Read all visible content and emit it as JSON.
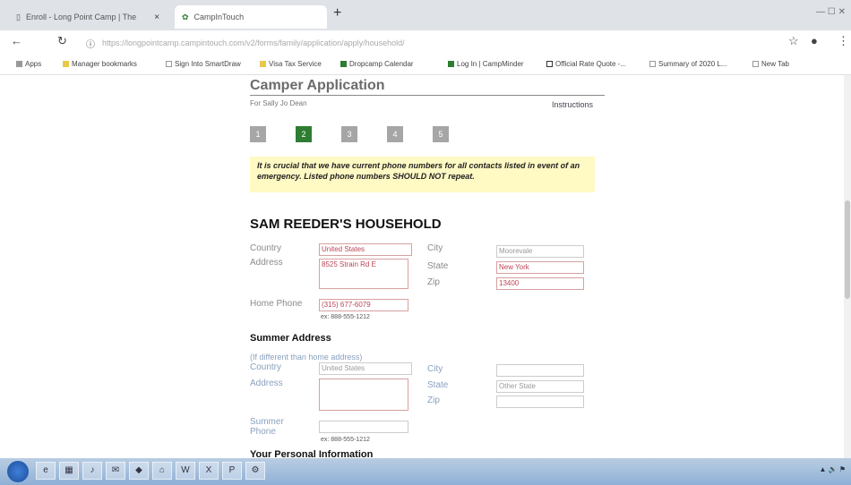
{
  "browser": {
    "tabs": [
      {
        "label": "Enroll - Long Point Camp | The",
        "close": "×"
      },
      {
        "label": "CampInTouch",
        "close": ""
      }
    ],
    "new_tab": "+",
    "url": "https://longpointcamp.campintouch.com/v2/forms/family/application/apply/household/"
  },
  "bookmarks": [
    {
      "label": "Apps",
      "icon": "apps-icon"
    },
    {
      "label": "Manager bookmarks",
      "icon": "folder-icon"
    },
    {
      "label": "Sign Into SmartDraw",
      "icon": "page-icon"
    },
    {
      "label": "Visa Tax Service",
      "icon": "folder-icon"
    },
    {
      "label": "Dropcamp Calendar",
      "icon": "green-icon"
    },
    {
      "label": "Log In | CampMinder",
      "icon": "green-icon"
    },
    {
      "label": "Official Rate Quote -...",
      "icon": "mail-icon"
    },
    {
      "label": "Summary of 2020 L...",
      "icon": "page-icon"
    },
    {
      "label": "New Tab",
      "icon": "page-icon"
    }
  ],
  "page": {
    "title": "Camper Application",
    "subtitle": "For Sally Jo Dean",
    "instructions": "Instructions",
    "steps": [
      "1",
      "2",
      "3",
      "4",
      "5"
    ],
    "active_step": "2",
    "notice": "It is crucial that we have current phone numbers for all contacts listed in event of an emergency. Listed phone numbers SHOULD NOT repeat.",
    "household_heading": "SAM REEDER'S HOUSEHOLD",
    "home": {
      "country_label": "Country",
      "country_value": "United States",
      "address_label": "Address",
      "address_value": "8525 Strain Rd E",
      "city_label": "City",
      "city_value": "Moorevale",
      "state_label": "State",
      "state_value": "New York",
      "zip_label": "Zip",
      "zip_value": "13400",
      "phone_label": "Home Phone",
      "phone_value": "(315) 677-6079",
      "phone_hint": "ex: 888-555-1212"
    },
    "summer": {
      "heading": "Summer Address",
      "note": "(If different than home address)",
      "country_label": "Country",
      "country_value": "United States",
      "address_label": "Address",
      "city_label": "City",
      "state_label": "State",
      "state_value": "Other State",
      "zip_label": "Zip",
      "phone_label": "Summer Phone",
      "phone_hint": "ex: 888-555-1212"
    },
    "personal_heading": "Your Personal Information"
  },
  "taskbar": {
    "buttons": [
      "e",
      "▦",
      "♪",
      "✉",
      "◆",
      "⌂",
      "W",
      "X",
      "P",
      "⚙"
    ],
    "tray": "▲ 🔊 ⚑"
  }
}
